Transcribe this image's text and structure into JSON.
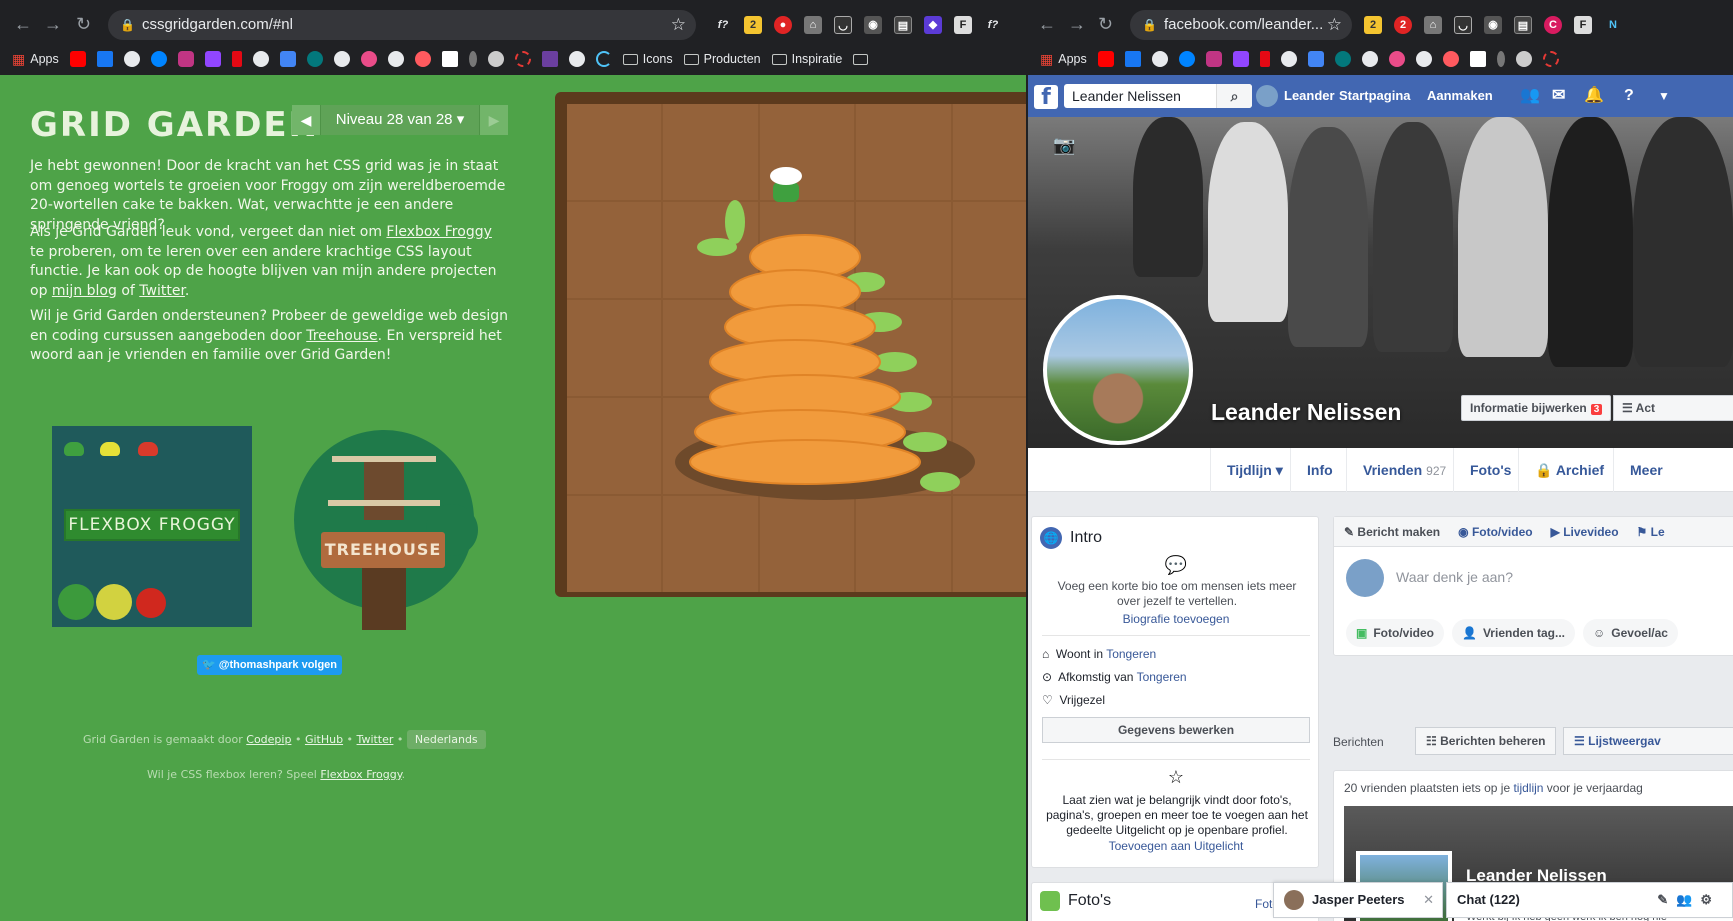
{
  "left_browser": {
    "url": "cssgridgarden.com/#nl",
    "bookmarks": [
      "Apps",
      "Icons",
      "Producten",
      "Inspiratie"
    ]
  },
  "right_browser": {
    "url": "facebook.com/leander...",
    "bookmarks": [
      "Apps"
    ]
  },
  "gridgarden": {
    "title": "GRID GARDEN",
    "level": "Niveau 28 van 28",
    "p1": "Je hebt gewonnen! Door de kracht van het CSS grid was je in staat om genoeg wortels te groeien voor Froggy om zijn wereldberoemde 20-wortellen cake te bakken. Wat, verwachtte je een andere springende vriend?",
    "p2_a": "Als je Grid Garden leuk vond, vergeet dan niet om ",
    "p2_link1": "Flexbox Froggy",
    "p2_b": " te proberen, om te leren over een andere krachtige CSS layout functie. Je kan ook op de hoogte blijven van mijn andere projecten op ",
    "p2_link2": "mijn blog",
    "p2_c": " of ",
    "p2_link3": "Twitter",
    "p2_d": ".",
    "p3_a": "Wil je Grid Garden ondersteunen? Probeer de geweldige web design en coding cursussen aangeboden door ",
    "p3_link": "Treehouse",
    "p3_b": ". En verspreid het woord aan je vrienden en familie over Grid Garden!",
    "froggy_sign": "FLEXBOX FROGGY",
    "treehouse_sign": "TREEHOUSE",
    "follow": "@thomashpark volgen",
    "footer1_a": "Grid Garden is gemaakt door ",
    "footer1_codepip": "Codepip",
    "footer1_sep1": " • ",
    "footer1_github": "GitHub",
    "footer1_sep2": " • ",
    "footer1_twitter": "Twitter",
    "footer1_sep3": " • ",
    "footer1_lang": "Nederlands",
    "footer2_a": "Wil je CSS flexbox leren? Speel ",
    "footer2_link": "Flexbox Froggy",
    "footer2_b": "."
  },
  "facebook": {
    "search": "Leander Nelissen",
    "nav": [
      "Leander",
      "Startpagina",
      "Aanmaken"
    ],
    "name": "Leander Nelissen",
    "update_btn": "Informatie bijwerken",
    "update_count": "3",
    "activity_btn": "Act",
    "tabs": {
      "tijdlijn": "Tijdlijn",
      "info": "Info",
      "vrienden": "Vrienden",
      "vrienden_count": "927",
      "fotos": "Foto's",
      "archief": "Archief",
      "meer": "Meer"
    },
    "intro_title": "Intro",
    "intro_text": "Voeg een korte bio toe om mensen iets meer over jezelf te vertellen.",
    "intro_link": "Biografie toevoegen",
    "woont_a": "Woont in ",
    "woont_b": "Tongeren",
    "afk_a": "Afkomstig van ",
    "afk_b": "Tongeren",
    "status": "Vrijgezel",
    "edit_btn": "Gegevens bewerken",
    "featured_text": "Laat zien wat je belangrijk vindt door foto's, pagina's, groepen en meer toe te voegen aan het gedeelte Uitgelicht op je openbare profiel.",
    "featured_link": "Toevoegen aan Uitgelicht",
    "photos_title": "Foto's",
    "photos_link": "Foto toe",
    "composer_tabs": [
      "Bericht maken",
      "Foto/video",
      "Livevideo",
      "Le"
    ],
    "composer_placeholder": "Waar denk je aan?",
    "composer_btns": [
      "Foto/video",
      "Vrienden tag...",
      "Gevoel/ac"
    ],
    "berichten": "Berichten",
    "berichten_beheren": "Berichten beheren",
    "lijstweergave": "Lijstweergav",
    "bday_a": "20 vrienden plaatsten iets op je ",
    "bday_link": "tijdlijn",
    "bday_b": " voor je verjaardag",
    "card_name": "Leander Nelissen",
    "card_sub": "Werkt bij Ik heb geen werk ik ben nog nie",
    "chat_user": "Jasper Peeters",
    "chat_label": "Chat (122)"
  }
}
